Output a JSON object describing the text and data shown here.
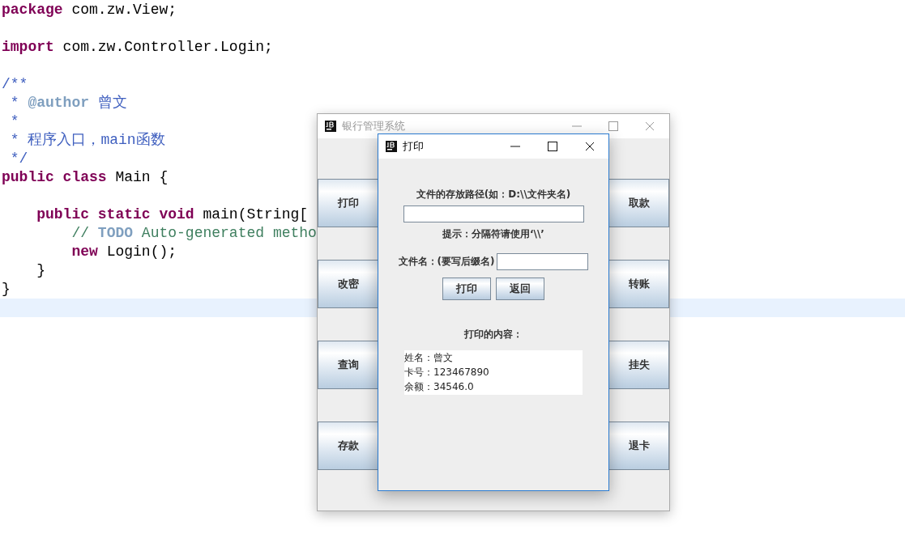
{
  "editor": {
    "lines": [
      {
        "tokens": [
          {
            "kind": "keyword",
            "text": "package"
          },
          {
            "kind": "plain",
            "text": " com.zw.View;"
          }
        ]
      },
      {
        "kind": "blank"
      },
      {
        "tokens": [
          {
            "kind": "keyword",
            "text": "import"
          },
          {
            "kind": "plain",
            "text": " com.zw.Controller.Login;"
          }
        ]
      },
      {
        "kind": "blank"
      },
      {
        "tokens": [
          {
            "kind": "javadoc",
            "text": "/**"
          }
        ]
      },
      {
        "tokens": [
          {
            "kind": "javadoc",
            "text": " * "
          },
          {
            "kind": "tag",
            "text": "@author"
          },
          {
            "kind": "javadoc",
            "text": " 曾文"
          }
        ]
      },
      {
        "tokens": [
          {
            "kind": "javadoc",
            "text": " *"
          }
        ]
      },
      {
        "tokens": [
          {
            "kind": "javadoc",
            "text": " * 程序入口，main函数"
          }
        ]
      },
      {
        "tokens": [
          {
            "kind": "javadoc",
            "text": " */"
          }
        ]
      },
      {
        "tokens": [
          {
            "kind": "keyword",
            "text": "public class"
          },
          {
            "kind": "plain",
            "text": " Main {"
          }
        ]
      },
      {
        "kind": "blank"
      },
      {
        "tokens": [
          {
            "kind": "keyword",
            "text": "    public static void"
          },
          {
            "kind": "plain",
            "text": " main(String["
          }
        ]
      },
      {
        "tokens": [
          {
            "kind": "comment",
            "text": "        // "
          },
          {
            "kind": "tag",
            "text": "TODO"
          },
          {
            "kind": "comment",
            "text": " Auto-generated metho"
          }
        ]
      },
      {
        "tokens": [
          {
            "kind": "keyword",
            "text": "        new"
          },
          {
            "kind": "plain",
            "text": " Login();"
          }
        ]
      },
      {
        "tokens": [
          {
            "kind": "plain",
            "text": "    }"
          }
        ]
      },
      {
        "tokens": [
          {
            "kind": "plain",
            "text": "}"
          }
        ]
      },
      {
        "kind": "blank",
        "selected": true
      }
    ]
  },
  "main_window": {
    "title": "银行管理系统",
    "active": false,
    "left_buttons": [
      "打印",
      "改密",
      "查询",
      "存款"
    ],
    "right_buttons": [
      "取款",
      "转账",
      "挂失",
      "退卡"
    ]
  },
  "print_dialog": {
    "title": "打印",
    "active": true,
    "path_label": "文件的存放路径(如：D:\\\\文件夹名)",
    "hint": "提示：分隔符请使用‘\\\\’",
    "filename_label": "文件名：(要写后缀名)",
    "buttons": [
      "打印",
      "返回"
    ],
    "content_label": "打印的内容：",
    "content_lines": [
      "姓名：曾文",
      "卡号：123467890",
      "余额：34546.0"
    ]
  }
}
